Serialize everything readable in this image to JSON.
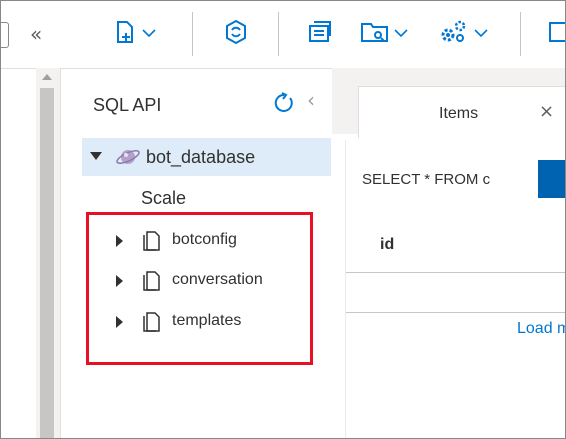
{
  "toolbar": {
    "collapse_glyph": "«",
    "buttons": [
      {
        "name": "new-container-icon",
        "has_dropdown": true
      },
      {
        "name": "github-icon",
        "has_dropdown": false
      },
      {
        "name": "open-full-screen-icon",
        "has_dropdown": false
      },
      {
        "name": "open-query-icon",
        "has_dropdown": true
      },
      {
        "name": "settings-icon",
        "has_dropdown": true
      }
    ],
    "accent_color": "#0078d4"
  },
  "tree": {
    "title": "SQL API",
    "collapse_glyph": "‹",
    "database": {
      "label": "bot_database",
      "expanded": true
    },
    "scale_label": "Scale",
    "collections": [
      {
        "label": "botconfig"
      },
      {
        "label": "conversation"
      },
      {
        "label": "templates"
      }
    ],
    "highlight_color": "#e81123"
  },
  "tabs": {
    "items": {
      "label": "Items",
      "close_glyph": "×"
    }
  },
  "query": {
    "text": "SELECT * FROM c"
  },
  "results": {
    "column_header": "id",
    "load_more": "Load m"
  }
}
